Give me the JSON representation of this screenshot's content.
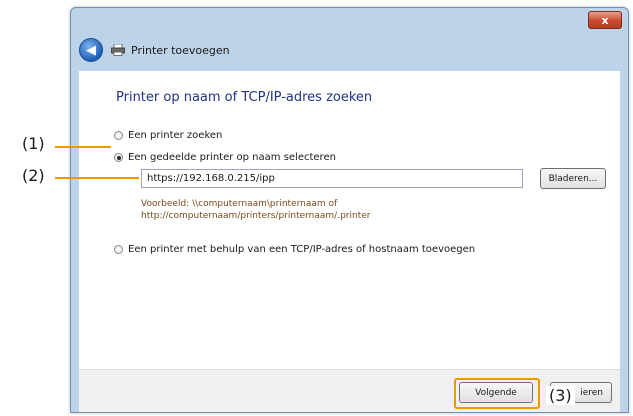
{
  "window": {
    "close_glyph": "x",
    "title": "Printer toevoegen",
    "back_icon": "back-arrow-icon",
    "printer_icon": "printer-icon"
  },
  "main": {
    "heading": "Printer op naam of TCP/IP-adres zoeken",
    "options": [
      {
        "label": "Een printer zoeken",
        "checked": false
      },
      {
        "label": "Een gedeelde printer op naam selecteren",
        "checked": true
      },
      {
        "label": "Een printer met behulp van een TCP/IP-adres of hostnaam toevoegen",
        "checked": false
      }
    ],
    "url_value": "https://192.168.0.215/ipp",
    "browse_label": "Bladeren...",
    "example_line1": "Voorbeeld: \\\\computernaam\\printernaam of",
    "example_line2": "http://computernaam/printers/printernaam/.printer"
  },
  "footer": {
    "next_label": "Volgende",
    "cancel_label": "ieren"
  },
  "callouts": {
    "c1": "(1)",
    "c2": "(2)",
    "c3": "(3)"
  },
  "colors": {
    "accent": "#f29600",
    "heading": "#1e3287",
    "frame": "#bcd3ea"
  }
}
